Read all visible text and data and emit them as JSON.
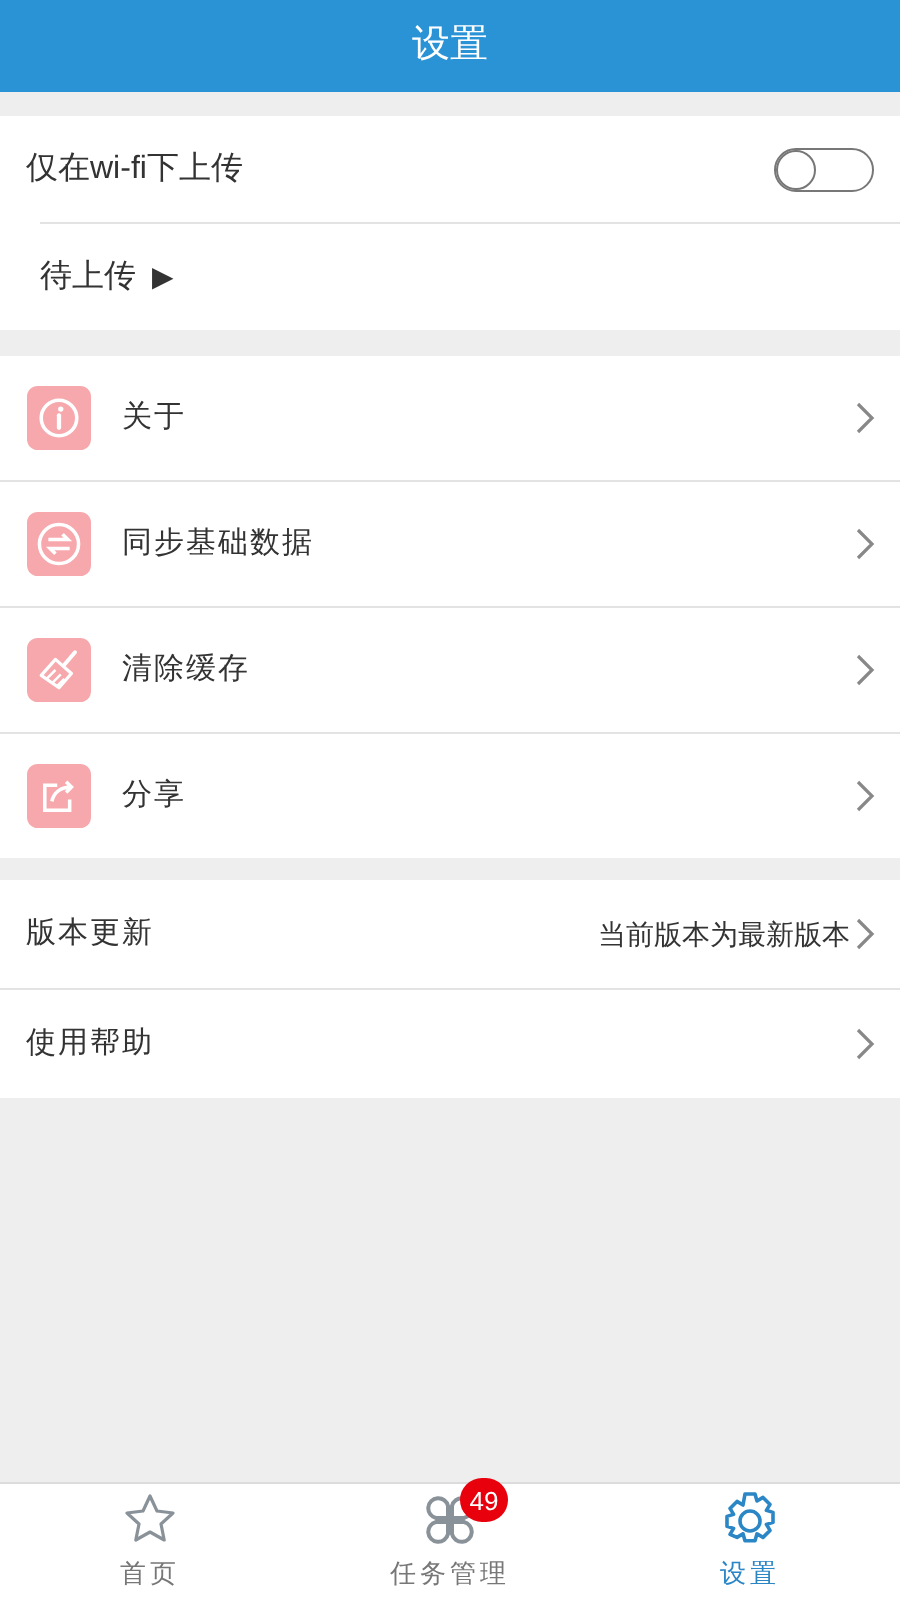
{
  "header": {
    "title": "设置"
  },
  "upload_section": {
    "wifi_only": {
      "label": "仅在wi-fi下上传",
      "on": false
    },
    "pending": {
      "label": "待上传",
      "arrow": "▶"
    }
  },
  "menu": [
    {
      "label": "关于",
      "kind": "info"
    },
    {
      "label": "同步基础数据",
      "kind": "sync"
    },
    {
      "label": "清除缓存",
      "kind": "broom"
    },
    {
      "label": "分享",
      "kind": "share"
    }
  ],
  "info_section": [
    {
      "label": "版本更新",
      "value": "当前版本为最新版本"
    },
    {
      "label": "使用帮助"
    }
  ],
  "tab_bar": [
    {
      "label": "首页",
      "kind": "star",
      "selected": false
    },
    {
      "label": "任务管理",
      "kind": "grid",
      "selected": false,
      "badge": "49"
    },
    {
      "label": "设置",
      "kind": "gear",
      "selected": true
    }
  ]
}
